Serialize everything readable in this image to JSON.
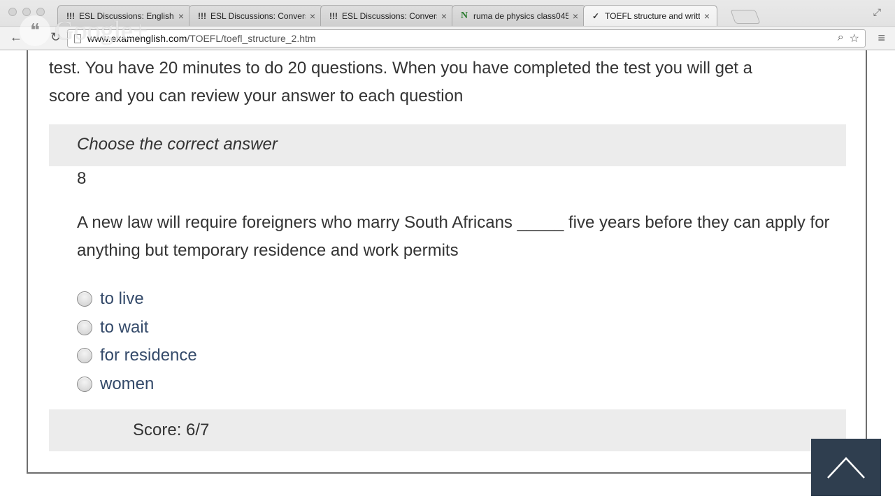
{
  "browser": {
    "tabs": [
      {
        "favicon": "!!!",
        "title": "ESL Discussions: English C",
        "active": false
      },
      {
        "favicon": "!!!",
        "title": "ESL Discussions: Conversa",
        "active": false
      },
      {
        "favicon": "!!!",
        "title": "ESL Discussions: Conversa",
        "active": false
      },
      {
        "favicon": "N",
        "title": "ruma de physics class045",
        "active": false
      },
      {
        "favicon": "✓",
        "title": "TOEFL structure and writt",
        "active": true
      }
    ],
    "url_host": "www.examenglish.com",
    "url_path": "/TOEFL/toefl_structure_2.htm",
    "watermark": "Google+"
  },
  "page": {
    "intro_line1": "test. You have 20 minutes to do 20 questions. When you have completed the test you will get a",
    "intro_line2": "score and you can review your answer to each question",
    "instruction": "Choose the correct answer",
    "question_number": "8",
    "question_text": "A new law will require foreigners who marry South Africans _____ five years before they can apply for anything but temporary residence and work permits",
    "options": [
      "to live",
      "to wait",
      "for residence",
      "women"
    ],
    "score": "Score: 6/7"
  },
  "colors": {
    "option_text": "#344a6a",
    "scroll_button": "#2f3e4f",
    "bar_background": "#ececec"
  }
}
